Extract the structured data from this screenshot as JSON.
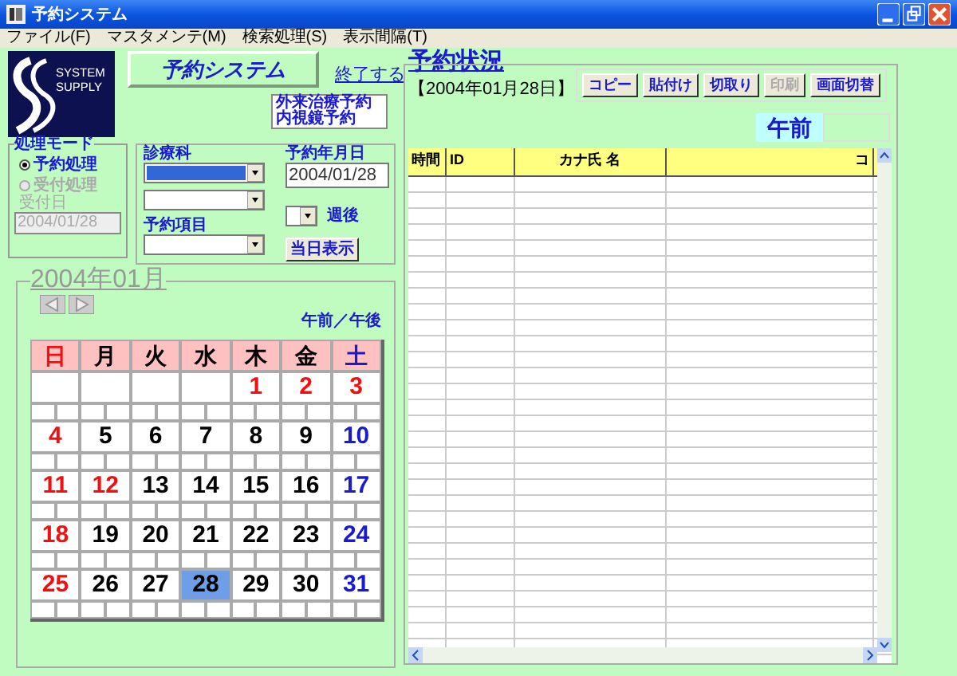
{
  "window": {
    "title": "予約システム"
  },
  "menu": [
    {
      "label": "ファイル(F)"
    },
    {
      "label": "マスタメンテ(M)"
    },
    {
      "label": "検索処理(S)"
    },
    {
      "label": "表示間隔(T)"
    }
  ],
  "logo": {
    "lines": [
      "SYSTEM",
      "SUPPLY"
    ]
  },
  "app_title": "予約システム",
  "exit_link": "終了する",
  "info_box": [
    "外来治療予約",
    "内視鏡予約"
  ],
  "mode_group": {
    "title": "処理モード",
    "options": [
      {
        "label": "予約処理",
        "selected": true,
        "disabled": false
      },
      {
        "label": "受付処理",
        "selected": false,
        "disabled": true
      }
    ],
    "reception_date": {
      "label": "受付日",
      "value": "2004/01/28",
      "disabled": true
    }
  },
  "department": {
    "label": "診療科",
    "focused": true
  },
  "item": {
    "label": "予約項目"
  },
  "date": {
    "label": "予約年月日",
    "value": "2004/01/28"
  },
  "weeks_later": {
    "label": "週後"
  },
  "today_button": "当日表示",
  "calendar": {
    "title": "2004年01月",
    "ampm_label": "午前／午後",
    "weekdays": [
      {
        "label": "日",
        "kind": "holiday"
      },
      {
        "label": "月",
        "kind": "weekday"
      },
      {
        "label": "火",
        "kind": "weekday"
      },
      {
        "label": "水",
        "kind": "weekday"
      },
      {
        "label": "木",
        "kind": "weekday"
      },
      {
        "label": "金",
        "kind": "weekday"
      },
      {
        "label": "土",
        "kind": "saturday"
      }
    ],
    "weeks": [
      [
        {
          "kind": "blank",
          "selected": false
        },
        {
          "kind": "blank",
          "selected": false
        },
        {
          "kind": "blank",
          "selected": false
        },
        {
          "kind": "blank",
          "selected": false
        },
        {
          "day": "1",
          "kind": "holiday",
          "selected": false
        },
        {
          "day": "2",
          "kind": "holiday",
          "selected": false
        },
        {
          "day": "3",
          "kind": "holiday",
          "selected": false
        }
      ],
      [
        {
          "day": "4",
          "kind": "holiday",
          "selected": false
        },
        {
          "day": "5",
          "kind": "weekday",
          "selected": false
        },
        {
          "day": "6",
          "kind": "weekday",
          "selected": false
        },
        {
          "day": "7",
          "kind": "weekday",
          "selected": false
        },
        {
          "day": "8",
          "kind": "weekday",
          "selected": false
        },
        {
          "day": "9",
          "kind": "weekday",
          "selected": false
        },
        {
          "day": "10",
          "kind": "saturday",
          "selected": false
        }
      ],
      [
        {
          "day": "11",
          "kind": "holiday",
          "selected": false
        },
        {
          "day": "12",
          "kind": "holiday",
          "selected": false
        },
        {
          "day": "13",
          "kind": "weekday",
          "selected": false
        },
        {
          "day": "14",
          "kind": "weekday",
          "selected": false
        },
        {
          "day": "15",
          "kind": "weekday",
          "selected": false
        },
        {
          "day": "16",
          "kind": "weekday",
          "selected": false
        },
        {
          "day": "17",
          "kind": "saturday",
          "selected": false
        }
      ],
      [
        {
          "day": "18",
          "kind": "holiday",
          "selected": false
        },
        {
          "day": "19",
          "kind": "weekday",
          "selected": false
        },
        {
          "day": "20",
          "kind": "weekday",
          "selected": false
        },
        {
          "day": "21",
          "kind": "weekday",
          "selected": false
        },
        {
          "day": "22",
          "kind": "weekday",
          "selected": false
        },
        {
          "day": "23",
          "kind": "weekday",
          "selected": false
        },
        {
          "day": "24",
          "kind": "saturday",
          "selected": false
        }
      ],
      [
        {
          "day": "25",
          "kind": "holiday",
          "selected": false
        },
        {
          "day": "26",
          "kind": "weekday",
          "selected": false
        },
        {
          "day": "27",
          "kind": "weekday",
          "selected": false
        },
        {
          "day": "28",
          "kind": "weekday",
          "selected": true
        },
        {
          "day": "29",
          "kind": "weekday",
          "selected": false
        },
        {
          "day": "30",
          "kind": "weekday",
          "selected": false
        },
        {
          "day": "31",
          "kind": "saturday",
          "selected": false
        }
      ]
    ]
  },
  "status": {
    "title": "予約状況",
    "date": "【2004年01月28日】",
    "buttons": [
      {
        "label": "コピー",
        "disabled": false
      },
      {
        "label": "貼付け",
        "disabled": false
      },
      {
        "label": "切取り",
        "disabled": false
      },
      {
        "label": "印刷",
        "disabled": true
      },
      {
        "label": "画面切替",
        "disabled": false
      }
    ],
    "period": "午前",
    "table": {
      "columns": [
        "時間",
        "ID",
        "カナ氏 名",
        "コ"
      ]
    }
  }
}
